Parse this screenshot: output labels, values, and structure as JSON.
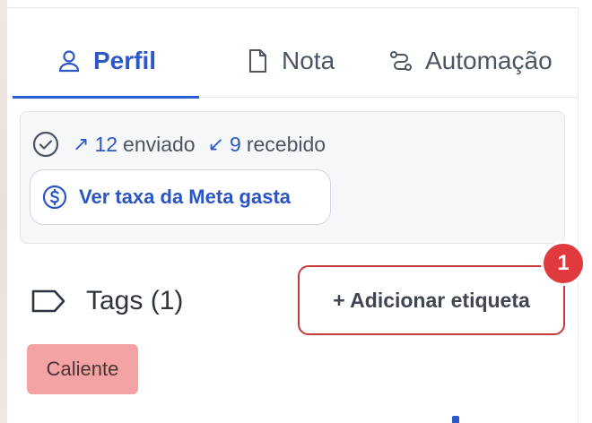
{
  "tabs": [
    {
      "label": "Perfil",
      "icon": "user-icon",
      "active": true
    },
    {
      "label": "Nota",
      "icon": "document-icon",
      "active": false
    },
    {
      "label": "Automação",
      "icon": "automation-icon",
      "active": false
    }
  ],
  "stats": {
    "sent_count": "12",
    "sent_label": "enviado",
    "received_count": "9",
    "received_label": "recebido",
    "meta_button_label": "Ver taxa da Meta gasta"
  },
  "tags": {
    "title": "Tags (1)",
    "add_label": "+ Adicionar etiqueta",
    "badge_count": "1",
    "items": [
      "Caliente"
    ]
  },
  "colors": {
    "accent": "#2e58c8",
    "highlight_border": "#c8383b",
    "badge": "#e03a3e",
    "chip_bg": "#f3a3a3"
  }
}
